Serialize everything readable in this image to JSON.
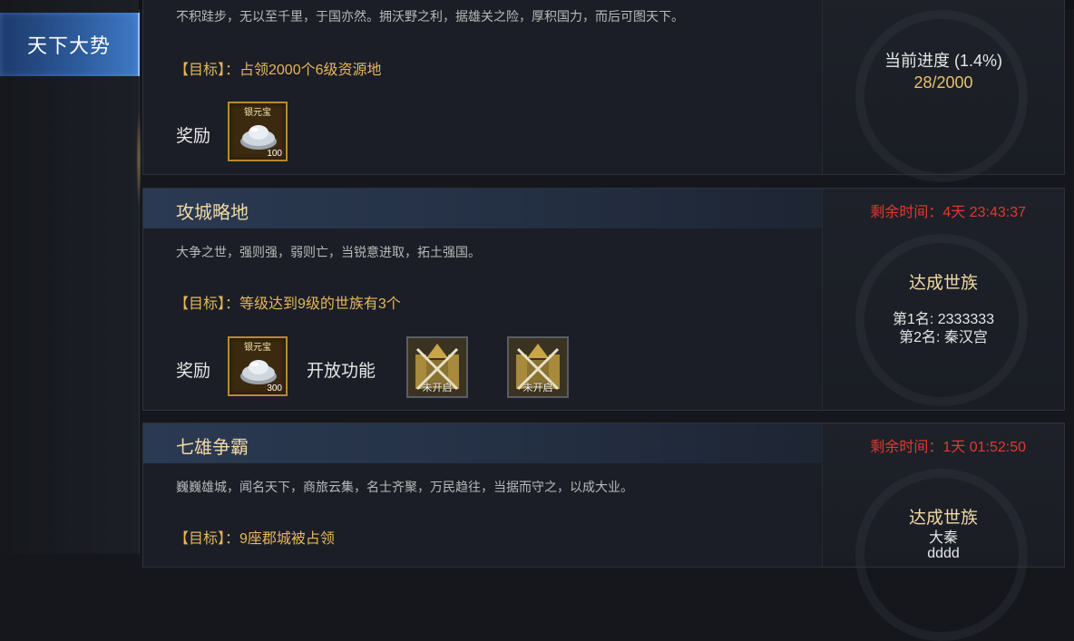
{
  "sidebar": {
    "tabs": [
      {
        "label": "天下大势"
      }
    ]
  },
  "panels": [
    {
      "desc": "不积跬步，无以至千里，于国亦然。拥沃野之利，据雄关之险，厚积国力，而后可图天下。",
      "goal": "【目标】：占领2000个6级资源地",
      "reward_label": "奖励",
      "rewards": [
        {
          "tag": "银元宝",
          "qty": "100"
        }
      ],
      "progress_label": "当前进度 (1.4%)",
      "progress_value": "28/2000",
      "progress_fraction": 0.014
    },
    {
      "title": "攻城略地",
      "timer": "剩余时间：4天 23:43:37",
      "desc": "大争之世，强则强，弱则亡，当锐意进取，拓土强国。",
      "goal": "【目标】：等级达到9级的世族有3个",
      "reward_label": "奖励",
      "rewards": [
        {
          "tag": "银元宝",
          "qty": "300"
        }
      ],
      "feature_label": "开放功能",
      "features": [
        {
          "status": "未开启"
        },
        {
          "status": "未开启"
        }
      ],
      "clan_title": "达成世族",
      "ranks": [
        "第1名: 2333333",
        "第2名: 秦汉宫"
      ]
    },
    {
      "title": "七雄争霸",
      "timer": "剩余时间：1天 01:52:50",
      "desc": "巍巍雄城，闻名天下，商旅云集，名士齐聚，万民趋往，当据而守之，以成大业。",
      "goal": "【目标】：9座郡城被占领",
      "clan_title": "达成世族",
      "ranks": [
        "大秦",
        "dddd"
      ]
    }
  ],
  "colors": {
    "accent_gold": "#e5b75a",
    "timer_red": "#e0392f",
    "tab_blue": "#2c5a9a"
  },
  "icons": {
    "reward": "silver-ingot-icon",
    "feature": "crossed-swords-fortress-icon"
  }
}
